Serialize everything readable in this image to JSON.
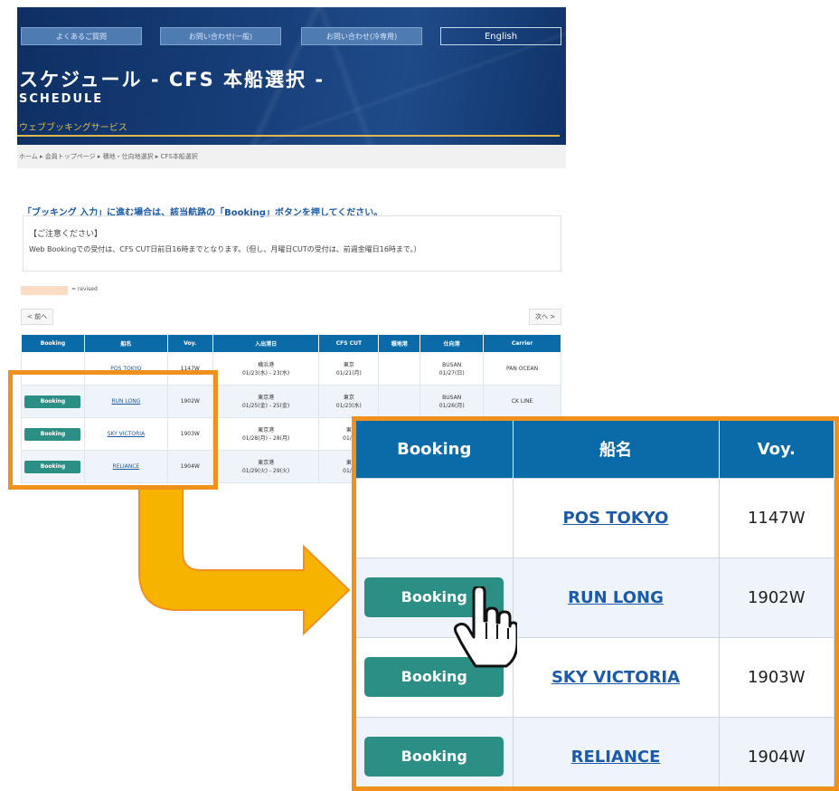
{
  "header": {
    "nav": [
      "よくあるご質問",
      "お問い合わせ(一般)",
      "お問い合わせ(冷専用)",
      "English"
    ],
    "title": "スケジュール - CFS 本船選択 -",
    "subtitle": "SCHEDULE",
    "service": "ウェブブッキングサービス"
  },
  "breadcrumb": "ホーム ▸ 会員トップページ ▸ 積地・仕向地選択 ▸ CFS本船選択",
  "notice": {
    "heading": "「ブッキング 入力」に進む場合は、該当航路の「Booking」ボタンを押してください。",
    "box_title": "【ご注意ください】",
    "box_text": "Web Bookingでの受付は、CFS CUT日前日16時までとなります。（但し、月曜日CUTの受付は、前週金曜日16時まで。）"
  },
  "legend": "= revised",
  "pager": {
    "prev": "< 前へ",
    "next": "次へ >"
  },
  "table": {
    "headers": [
      "Booking",
      "船名",
      "Voy.",
      "入出港日",
      "CFS CUT",
      "積地港",
      "仕向港",
      "Carrier"
    ],
    "rows": [
      {
        "vessel": "POS TOKYO",
        "voy": "1147W",
        "port": "横浜港",
        "dates": "01/23(水) - 23(水)",
        "cut_city": "東京",
        "cut_date": "01/21(月)",
        "load": "",
        "dest": "BUSAN",
        "dest_date": "01/27(日)",
        "carrier": "PAN OCEAN",
        "booking": false
      },
      {
        "vessel": "RUN LONG",
        "voy": "1902W",
        "port": "東京港",
        "dates": "01/25(金) - 25(金)",
        "cut_city": "東京",
        "cut_date": "01/23(水)",
        "load": "",
        "dest": "BUSAN",
        "dest_date": "01/26(月)",
        "carrier": "CK LINE",
        "booking": true
      },
      {
        "vessel": "SKY VICTORIA",
        "voy": "1903W",
        "port": "東京港",
        "dates": "01/28(月) - 28(月)",
        "cut_city": "東",
        "cut_date": "01/2",
        "load": "",
        "dest": "",
        "dest_date": "",
        "carrier": "",
        "booking": true
      },
      {
        "vessel": "RELIANCE",
        "voy": "1904W",
        "port": "東京港",
        "dates": "01/29(火) - 29(火)",
        "cut_city": "東",
        "cut_date": "01/2",
        "load": "",
        "dest": "",
        "dest_date": "",
        "carrier": "",
        "booking": true
      }
    ]
  },
  "zoom": {
    "headers": [
      "Booking",
      "船名",
      "Voy."
    ],
    "button_label": "Booking",
    "rows": [
      {
        "vessel": "POS TOKYO",
        "voy": "1147W",
        "booking": false
      },
      {
        "vessel": "RUN LONG",
        "voy": "1902W",
        "booking": true
      },
      {
        "vessel": "SKY VICTORIA",
        "voy": "1903W",
        "booking": true
      },
      {
        "vessel": "RELIANCE",
        "voy": "1904W",
        "booking": true
      }
    ]
  },
  "colors": {
    "header_blue": "#0b6aa8",
    "button_teal": "#2b8f86",
    "highlight_orange": "#f0911e",
    "arrow_yellow": "#f6b400"
  },
  "icons": {
    "cursor": "hand-pointer-icon",
    "arrow": "bent-arrow-icon"
  }
}
